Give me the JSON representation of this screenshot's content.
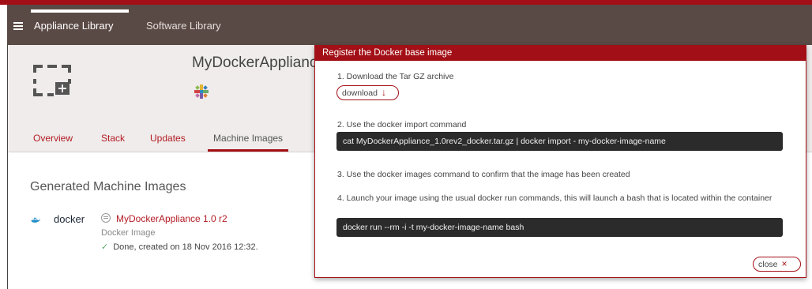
{
  "nav": {
    "items": [
      {
        "label": "Appliance Library",
        "active": true
      },
      {
        "label": "Software Library",
        "active": false
      }
    ]
  },
  "appliance": {
    "title": "MyDockerAppliance",
    "tabs": [
      {
        "label": "Overview"
      },
      {
        "label": "Stack"
      },
      {
        "label": "Updates"
      },
      {
        "label": "Machine Images",
        "active": true
      }
    ]
  },
  "content": {
    "section_title": "Generated Machine Images",
    "image": {
      "platform_logo": "docker",
      "name": "MyDockerAppliance 1.0 r2",
      "type": "Docker Image",
      "status": "Done, created on 18 Nov 2016 12:32."
    }
  },
  "modal": {
    "title": "Register the Docker base image",
    "step1": "1. Download the Tar GZ archive",
    "download_label": "download",
    "step2": "2. Use the docker import command",
    "command1": "cat MyDockerAppliance_1.0rev2_docker.tar.gz | docker import - my-docker-image-name",
    "step3": "3. Use the docker images command to confirm that the image has been created",
    "step4": "4. Launch your image using the usual docker run commands, this will launch a bash that is located within the container",
    "command2": "docker run --rm -i -t my-docker-image-name bash",
    "close_label": "close"
  },
  "colors": {
    "accent": "#a30f16",
    "navbar": "#5a4a45",
    "header_bg": "#efeceb",
    "command_bg": "#2b2b2b"
  }
}
